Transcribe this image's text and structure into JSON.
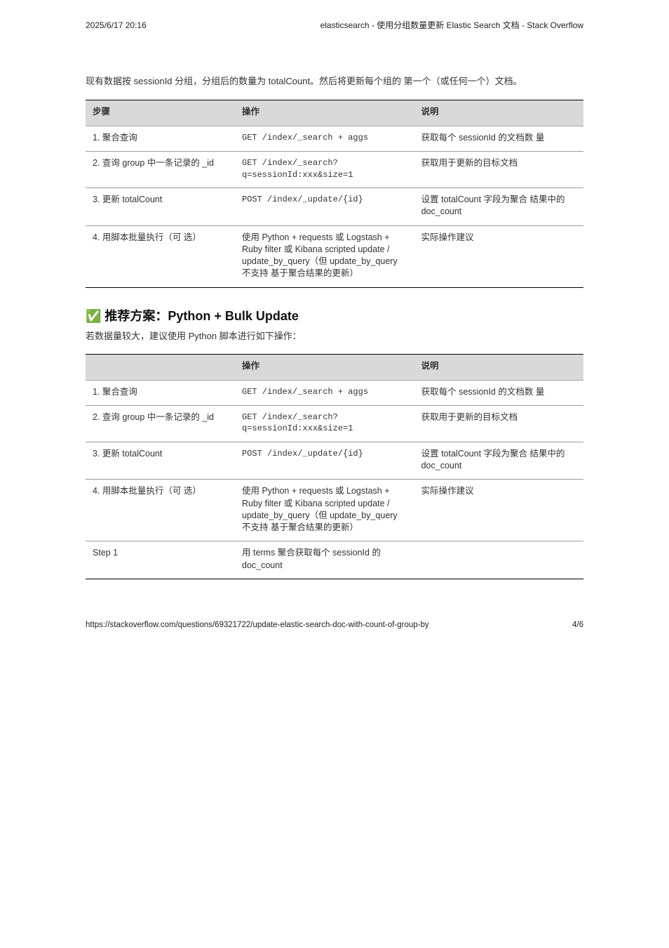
{
  "header": {
    "date": "2025/6/17 20:16",
    "topic": "elasticsearch - 使用分组数量更新 Elastic Search 文档 - Stack Overflow"
  },
  "intro": "现有数据按 sessionId 分组，分组后的数量为 totalCount。然后将更新每个组的 第一个（或任何一个）文档。",
  "table1": {
    "headers": [
      "步骤",
      "操作",
      "说明"
    ],
    "rows": [
      [
        "1. 聚合查询",
        "GET /index/_search + aggs",
        "获取每个 sessionId 的文档数 量"
      ],
      [
        "2. 查询 group 中一条记录的 _id",
        "GET /index/_search?q=sessionId:xxx&size=1",
        "获取用于更新的目标文档"
      ],
      [
        "3. 更新 totalCount",
        "POST /index/_update/{id}",
        "设置 totalCount 字段为聚合 结果中的 doc_count"
      ],
      [
        "4. ⽤脚本批量执⾏（可 选）",
        "使⽤ Python + requests 或 Logstash + Ruby filter 或 Kibana scripted update / update_by_query（但 update_by_query 不⽀持 基于聚合结果的更新）",
        "实际操作建议"
      ]
    ]
  },
  "section": {
    "title": "✅ 推荐方案：Python + Bulk Update",
    "body": "若数据量较大，建议使用 Python 脚本进行如下操作："
  },
  "table2": {
    "headers": [
      "",
      "操作",
      "说明"
    ],
    "rows": [
      [
        "1. 聚合查询",
        "GET /index/_search + aggs",
        "获取每个 sessionId 的文档数 量"
      ],
      [
        "2. 查询 group 中一条记录的 _id",
        "GET /index/_search?q=sessionId:xxx&size=1",
        "获取用于更新的目标文档"
      ],
      [
        "3. 更新 totalCount",
        "POST /index/_update/{id}",
        "设置 totalCount 字段为聚合 结果中的 doc_count"
      ],
      [
        "4. ⽤脚本批量执⾏（可 选）",
        "使⽤ Python + requests 或 Logstash + Ruby filter 或 Kibana scripted update / update_by_query（但 update_by_query 不⽀持 基于聚合结果的更新）",
        "实际操作建议"
      ],
      [
        "Step 1",
        "⽤ terms 聚合获取每个 sessionId 的 doc_count",
        ""
      ]
    ]
  },
  "footer": {
    "url": "https://stackoverflow.com/questions/69321722/update-elastic-search-doc-with-count-of-group-by",
    "page": "4/6"
  }
}
